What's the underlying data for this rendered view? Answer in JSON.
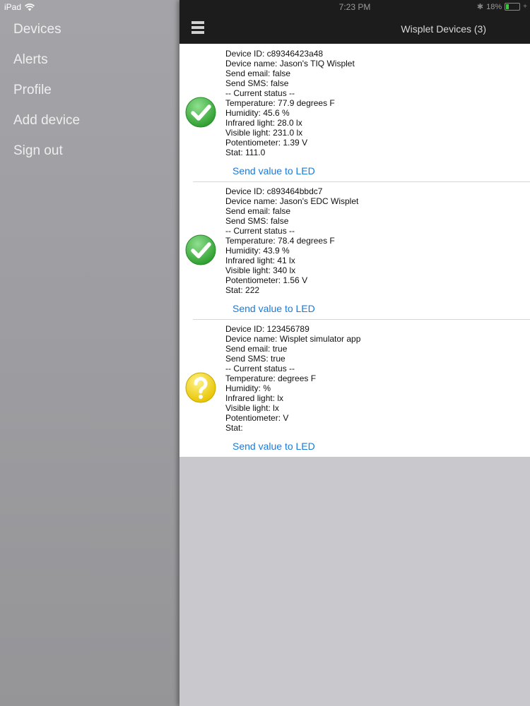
{
  "status_bar": {
    "device": "iPad",
    "time": "7:23 PM",
    "battery": "18%"
  },
  "sidebar": {
    "items": [
      {
        "label": "Devices"
      },
      {
        "label": "Alerts"
      },
      {
        "label": "Profile"
      },
      {
        "label": "Add device"
      },
      {
        "label": "Sign out"
      }
    ]
  },
  "header": {
    "title": "Wisplet Devices (3)"
  },
  "colors": {
    "link": "#1a7ad9",
    "ok_green": "#3fb33f",
    "unknown_yellow": "#f4d400"
  },
  "devices": [
    {
      "status_icon": "check-icon",
      "lines": [
        "Device ID: c89346423a48",
        "Device name: Jason's TIQ Wisplet",
        "Send email: false",
        "Send SMS: false",
        "-- Current status --",
        "Temperature: 77.9 degrees F",
        "Humidity: 45.6 %",
        "Infrared light: 28.0 lx",
        "Visible light: 231.0 lx",
        "Potentiometer: 1.39 V",
        "Stat: 111.0"
      ],
      "action": "Send value to LED"
    },
    {
      "status_icon": "check-icon",
      "lines": [
        "Device ID: c893464bbdc7",
        "Device name: Jason's EDC Wisplet",
        "Send email: false",
        "Send SMS: false",
        "-- Current status --",
        "Temperature: 78.4 degrees F",
        "Humidity: 43.9 %",
        "Infrared light: 41 lx",
        "Visible light: 340 lx",
        "Potentiometer: 1.56 V",
        "Stat: 222"
      ],
      "action": "Send value to LED"
    },
    {
      "status_icon": "question-icon",
      "lines": [
        "Device ID: 123456789",
        "Device name: Wisplet simulator app",
        "Send email: true",
        "Send SMS: true",
        "-- Current status --",
        "Temperature:  degrees F",
        "Humidity:  %",
        "Infrared light:  lx",
        "Visible light:  lx",
        "Potentiometer:  V",
        "Stat:"
      ],
      "action": "Send value to LED"
    }
  ]
}
